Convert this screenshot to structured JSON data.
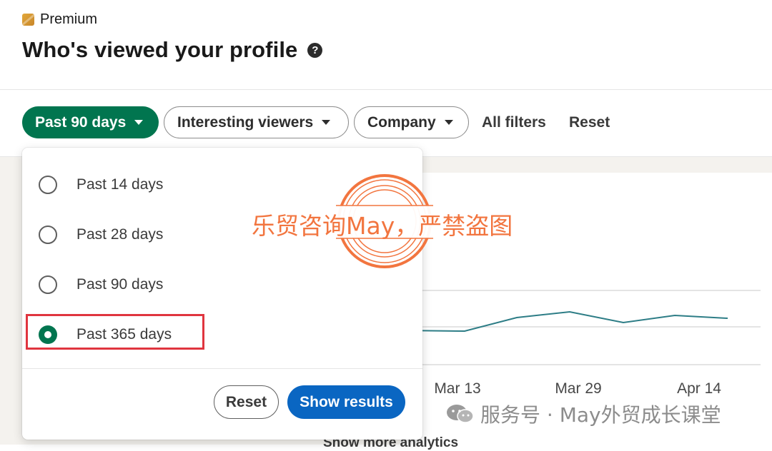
{
  "header": {
    "premium_label": "Premium",
    "title": "Who's viewed your profile",
    "help_icon": "question-circle-icon"
  },
  "filters": {
    "date_range": "Past 90 days",
    "viewers": "Interesting viewers",
    "company": "Company",
    "all_filters": "All filters",
    "reset": "Reset",
    "active_color": "#01754f"
  },
  "dropdown": {
    "options": [
      {
        "label": "Past 14 days",
        "selected": false
      },
      {
        "label": "Past 28 days",
        "selected": false
      },
      {
        "label": "Past 90 days",
        "selected": false
      },
      {
        "label": "Past 365 days",
        "selected": true
      }
    ],
    "reset_label": "Reset",
    "show_results_label": "Show results",
    "primary_color": "#0a66c2"
  },
  "chart": {
    "x_ticks": [
      "Mar 13",
      "Mar 29",
      "Apr 14"
    ]
  },
  "footer": {
    "show_more": "Show more analytics"
  },
  "watermarks": {
    "overlay_text": "乐贸咨询May，严禁盗图",
    "wechat_text": "服务号 · May外贸成长课堂",
    "stamp_color": "#f2753f"
  }
}
